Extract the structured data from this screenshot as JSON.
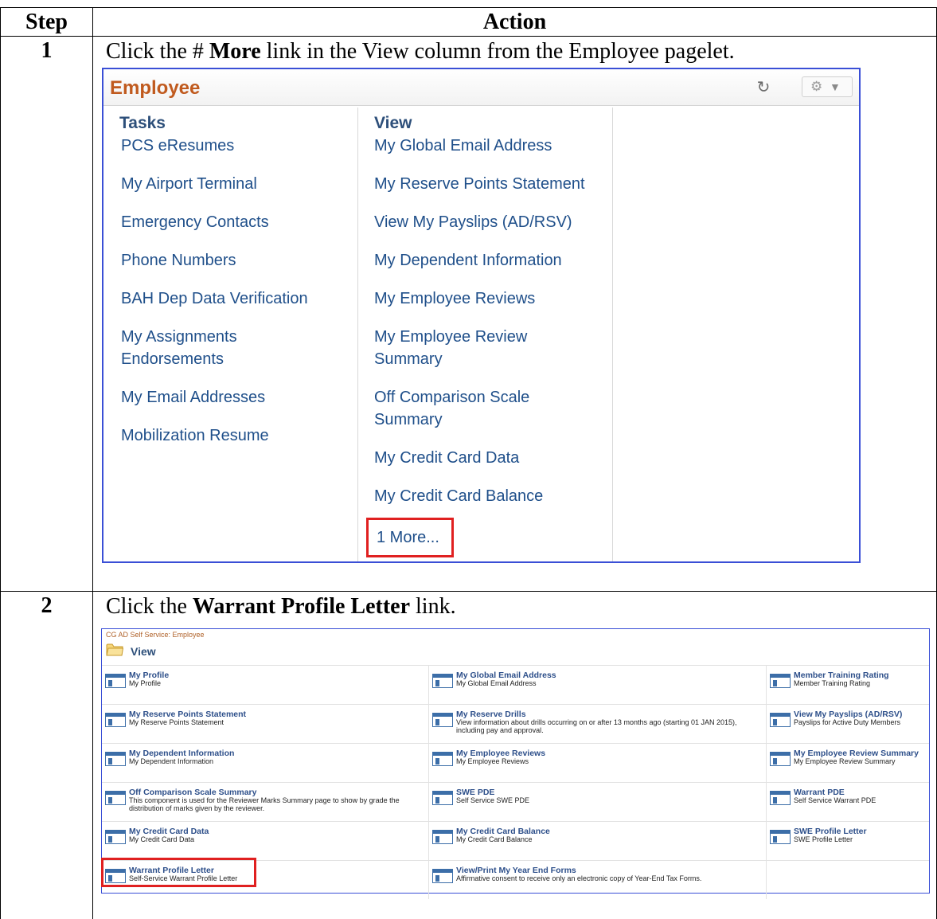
{
  "table": {
    "header_step": "Step",
    "header_action": "Action"
  },
  "step1": {
    "number": "1",
    "instruction_pre": "Click the # ",
    "instruction_bold": "More",
    "instruction_post": " link in the View column from the Employee pagelet."
  },
  "pagelet": {
    "title": "Employee",
    "refresh_icon": "refresh-icon",
    "settings_icon": "gear-icon",
    "tasks_title": "Tasks",
    "view_title": "View",
    "tasks": [
      "PCS eResumes",
      "My Airport Terminal",
      "Emergency Contacts",
      "Phone Numbers",
      "BAH Dep Data Verification",
      "My Assignments Endorsements",
      "My Email Addresses",
      "Mobilization Resume"
    ],
    "view": [
      "My Global Email Address",
      "My Reserve Points Statement",
      "View My Payslips (AD/RSV)",
      "My Dependent Information",
      "My Employee Reviews",
      "My Employee Review Summary",
      "Off Comparison Scale Summary",
      "My Credit Card Data",
      "My Credit Card Balance"
    ],
    "more_link": "1 More..."
  },
  "step2": {
    "number": "2",
    "instruction_pre": "Click the ",
    "instruction_bold": "Warrant Profile Letter",
    "instruction_post": " link."
  },
  "viewgrid": {
    "breadcrumb": "CG AD Self Service: Employee",
    "title": "View",
    "rows": [
      [
        {
          "link": "My Profile",
          "desc": "My Profile"
        },
        {
          "link": "My Global Email Address",
          "desc": "My Global Email Address"
        },
        {
          "link": "Member Training Rating",
          "desc": "Member Training Rating"
        }
      ],
      [
        {
          "link": "My Reserve Points Statement",
          "desc": "My Reserve Points Statement"
        },
        {
          "link": "My Reserve Drills",
          "desc": "View information about drills occurring on or after 13 months ago (starting 01 JAN 2015), including pay and approval."
        },
        {
          "link": "View My Payslips (AD/RSV)",
          "desc": "Payslips for Active Duty Members"
        }
      ],
      [
        {
          "link": "My Dependent Information",
          "desc": "My Dependent Information"
        },
        {
          "link": "My Employee Reviews",
          "desc": "My Employee Reviews"
        },
        {
          "link": "My Employee Review Summary",
          "desc": "My Employee Review Summary"
        }
      ],
      [
        {
          "link": "Off Comparison Scale Summary",
          "desc": "This component is used for the Reviewer Marks Summary page to show by grade the distribution of marks given by the reviewer."
        },
        {
          "link": "SWE PDE",
          "desc": "Self Service SWE PDE"
        },
        {
          "link": "Warrant PDE",
          "desc": "Self Service Warrant PDE"
        }
      ],
      [
        {
          "link": "My Credit Card Data",
          "desc": "My Credit Card Data"
        },
        {
          "link": "My Credit Card Balance",
          "desc": "My Credit Card Balance"
        },
        {
          "link": "SWE Profile Letter",
          "desc": "SWE Profile Letter"
        }
      ],
      [
        {
          "link": "Warrant Profile Letter",
          "desc": "Self-Service Warrant Profile Letter"
        },
        {
          "link": "View/Print My Year End Forms",
          "desc": "Affirmative consent to receive only an electronic copy of Year-End Tax Forms."
        },
        null
      ]
    ]
  },
  "colors": {
    "pagelet_border": "#3a4fd6",
    "highlight": "#e02020",
    "pagelet_title": "#c05a1e",
    "link": "#1f4f8a"
  }
}
